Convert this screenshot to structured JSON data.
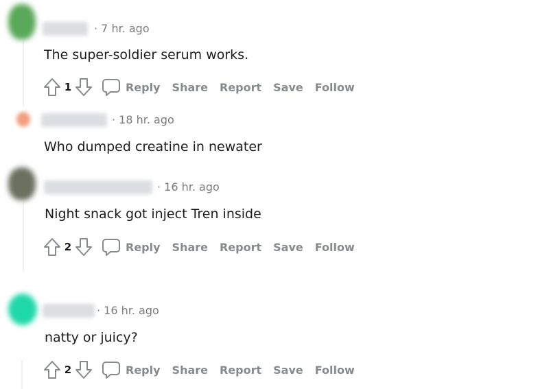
{
  "comments": [
    {
      "time": "· 7 hr. ago",
      "body": "The super-soldier serum works.",
      "votes": "1",
      "avatar_color": "#5aa85a",
      "actions": {
        "reply": "Reply",
        "share": "Share",
        "report": "Report",
        "save": "Save",
        "follow": "Follow"
      }
    },
    {
      "time": "· 18 hr. ago",
      "body": "Who dumped creatine in newater",
      "avatar_color": "#f0a080"
    },
    {
      "time": "· 16 hr. ago",
      "body": "Night snack got inject Tren inside",
      "votes": "2",
      "avatar_color": "#6b7060",
      "actions": {
        "reply": "Reply",
        "share": "Share",
        "report": "Report",
        "save": "Save",
        "follow": "Follow"
      }
    },
    {
      "time": "· 16 hr. ago",
      "body": "natty or juicy?",
      "votes": "2",
      "avatar_color": "#1fd8a8",
      "actions": {
        "reply": "Reply",
        "share": "Share",
        "report": "Report",
        "save": "Save",
        "follow": "Follow"
      }
    }
  ],
  "icons": {
    "upvote": "arrow-up-outline",
    "downvote": "arrow-down-outline",
    "comment": "speech-bubble-outline"
  }
}
